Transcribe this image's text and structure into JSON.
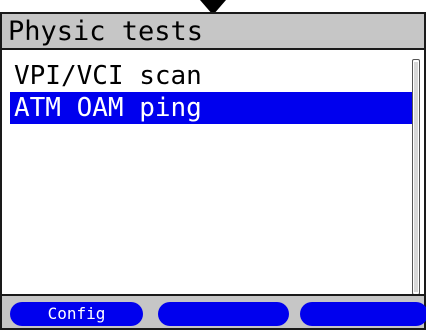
{
  "title": "Physic tests",
  "menu": {
    "items": [
      {
        "label": "VPI/VCI scan",
        "selected": false
      },
      {
        "label": "ATM OAM ping",
        "selected": true
      }
    ]
  },
  "softkeys": {
    "key1": "Config",
    "key2": "",
    "key3": ""
  },
  "colors": {
    "selection": "#0000ee",
    "bar": "#c6c6c6"
  },
  "icons": {
    "top": "down-arrow-icon"
  }
}
